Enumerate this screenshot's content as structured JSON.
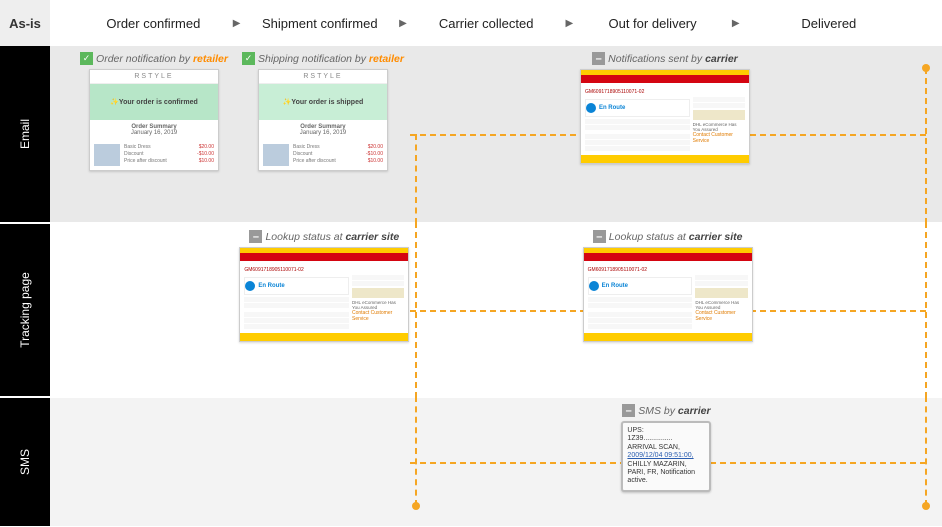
{
  "header": {
    "asis": "As-is"
  },
  "stages": [
    "Order confirmed",
    "Shipment confirmed",
    "Carrier collected",
    "Out for delivery",
    "Delivered"
  ],
  "rows": {
    "email": "Email",
    "tracking": "Tracking page",
    "sms": "SMS"
  },
  "captions": {
    "order_notif_prefix": "Order notification by ",
    "order_notif_actor": "retailer",
    "ship_notif_prefix": "Shipping notification by ",
    "ship_notif_actor": "retailer",
    "carrier_notif_prefix": "Notifications sent by ",
    "carrier_notif_actor": "carrier",
    "lookup_prefix": "Lookup status at ",
    "lookup_actor": "carrier site",
    "sms_prefix": "SMS by ",
    "sms_actor": "carrier"
  },
  "thumb_retail": {
    "brand": "RSTYLE",
    "order_confirmed": "✨Your order is confirmed",
    "order_shipped": "✨Your order is shipped",
    "summary_title": "Order Summary",
    "summary_date": "January 16, 2019",
    "item_name": "Basic Dress",
    "item_discount": "Discount",
    "item_after": "Price after discount",
    "price": "$20.00",
    "disc": "-$10.00",
    "after": "$10.00"
  },
  "thumb_dhl": {
    "tracking_no": "GM6091718905110071-02",
    "status": "En Route",
    "adv": "DHL eCommerce Has You Assured",
    "csr": "Contact Customer Service"
  },
  "sms": {
    "l1": "UPS:",
    "l2": "1Z39...............",
    "l3": "ARRIVAL SCAN,",
    "l4": "2009/12/04 09:51:00,",
    "l5": "CHILLY MAZARIN,",
    "l6": "PARI, FR, Notification",
    "l7": "active."
  }
}
